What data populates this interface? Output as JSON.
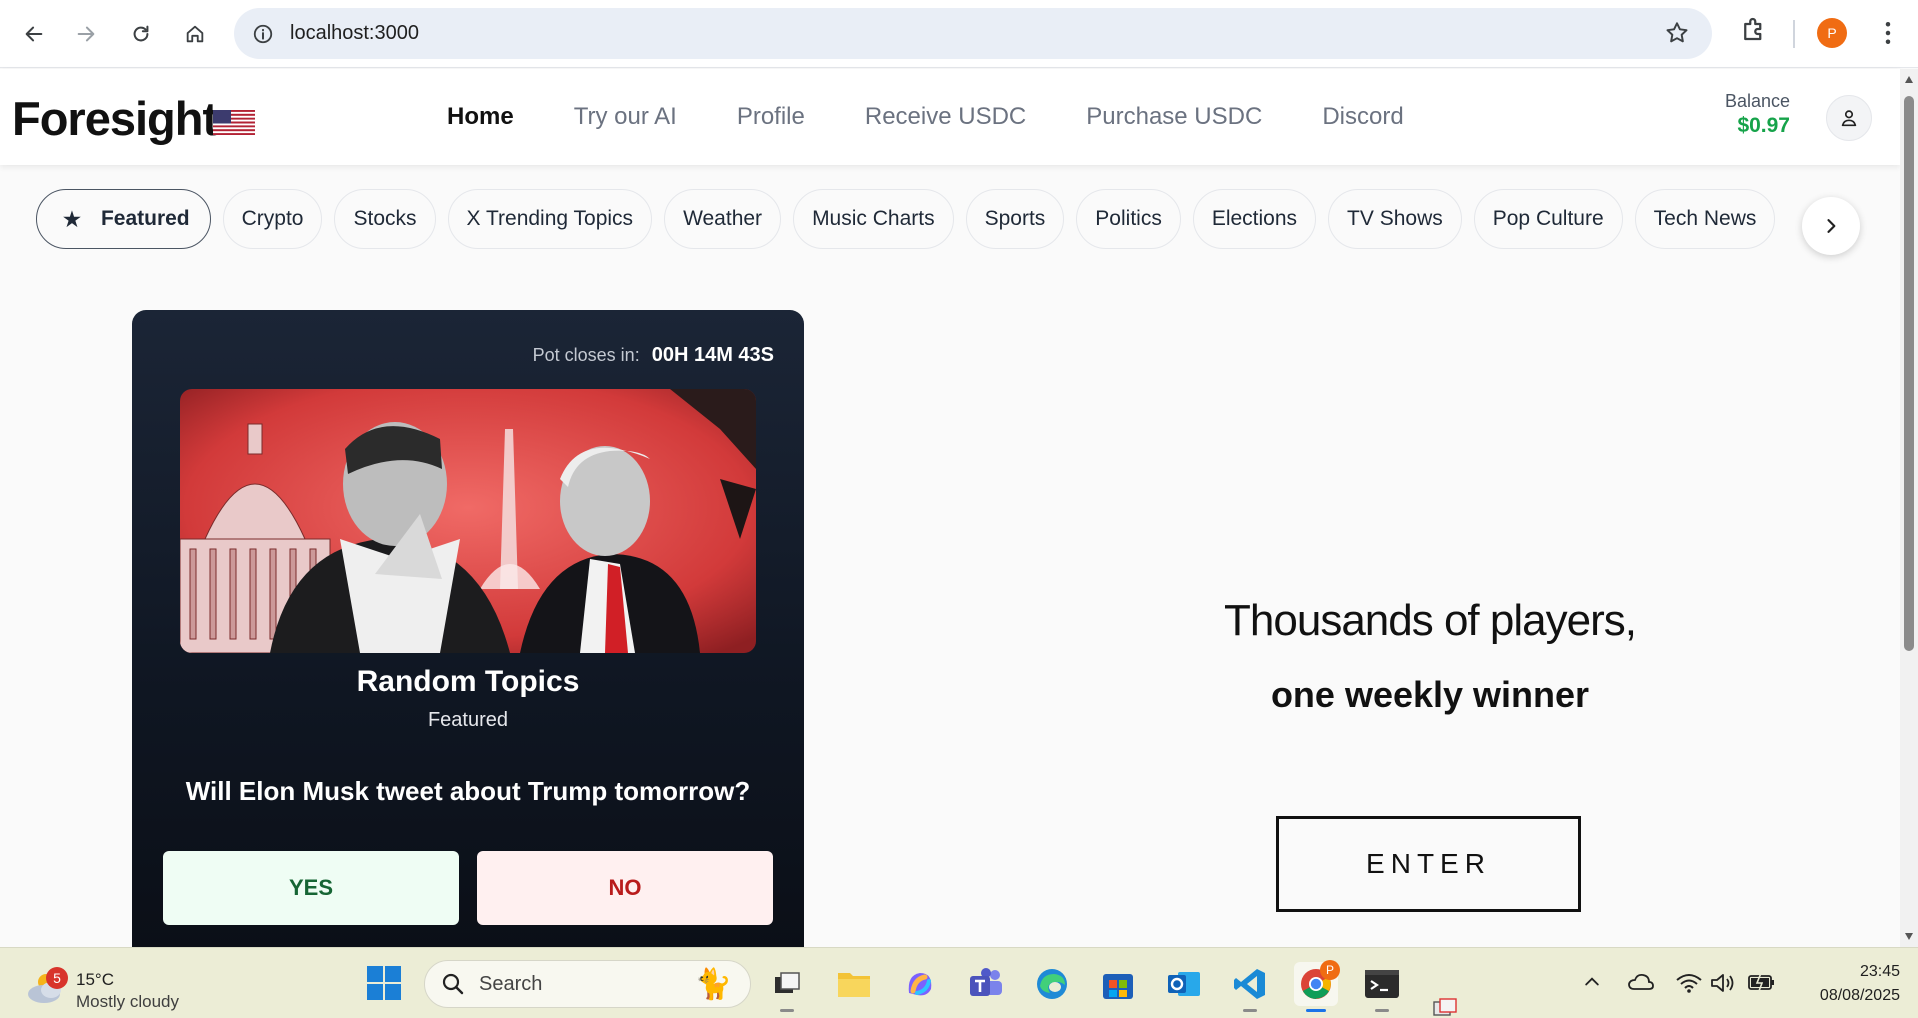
{
  "browser": {
    "url": "localhost:3000",
    "profile_initial": "P"
  },
  "header": {
    "logo": "Foresight",
    "nav": [
      "Home",
      "Try our AI",
      "Profile",
      "Receive USDC",
      "Purchase USDC",
      "Discord"
    ],
    "active_nav": "Home",
    "balance_label": "Balance",
    "balance_value": "$0.97"
  },
  "categories": {
    "featured": "Featured",
    "items": [
      "Crypto",
      "Stocks",
      "X Trending Topics",
      "Weather",
      "Music Charts",
      "Sports",
      "Politics",
      "Elections",
      "TV Shows",
      "Pop Culture",
      "Tech News"
    ]
  },
  "card": {
    "pot_label": "Pot closes in:",
    "pot_time": "00H 14M 43S",
    "title": "Random Topics",
    "subtitle": "Featured",
    "question": "Will Elon Musk tweet about Trump tomorrow?",
    "yes_label": "YES",
    "no_label": "NO"
  },
  "hero": {
    "line1": "Thousands of players,",
    "line2": "one weekly winner",
    "button": "ENTER"
  },
  "taskbar": {
    "weather_badge": "5",
    "weather_temp": "15°C",
    "weather_desc": "Mostly cloudy",
    "search_label": "Search",
    "chrome_badge": "P",
    "time": "23:45",
    "date": "08/08/2025"
  },
  "colors": {
    "balance_green": "#16a34a",
    "card_bg": "#111827",
    "yes_text": "#166534",
    "no_text": "#b91c1c",
    "profile_orange": "#f06c13"
  }
}
